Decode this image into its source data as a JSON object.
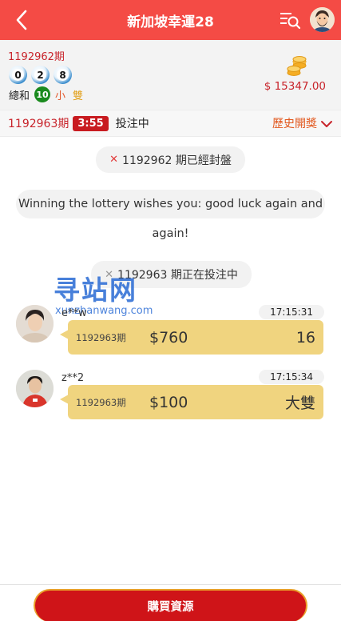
{
  "header": {
    "title": "新加坡幸運28",
    "back_icon": "chevron-left-icon",
    "search_icon": "list-search-icon"
  },
  "last_draw": {
    "period": "1192962期",
    "numbers": [
      "0",
      "2",
      "8"
    ],
    "sum_label": "總和",
    "sum": "10",
    "size": "小",
    "parity": "雙",
    "balance": "$ 15347.00"
  },
  "status": {
    "current_period": "1192963期",
    "countdown": "3:55",
    "state": "投注中",
    "history_label": "歷史開獎"
  },
  "messages": {
    "closed_notice": "1192962 期已經封盤",
    "wish": "Winning the lottery wishes you: good luck again and again!",
    "open_notice": "1192963 期正在投注中"
  },
  "watermark": {
    "main": "寻站网",
    "sub": "xunzhanwang.com"
  },
  "bets": [
    {
      "user": "e**w",
      "time": "17:15:31",
      "period": "1192963期",
      "amount": "$760",
      "pick": "16"
    },
    {
      "user": "z**2",
      "time": "17:15:34",
      "period": "1192963期",
      "amount": "$100",
      "pick": "大雙"
    }
  ],
  "footer": {
    "buy_label": "購買資源"
  },
  "colors": {
    "header_red": "#f44b45",
    "accent_red": "#c8242b",
    "bubble_yellow": "#f0d47f",
    "sum_green": "#1a8a1e"
  }
}
